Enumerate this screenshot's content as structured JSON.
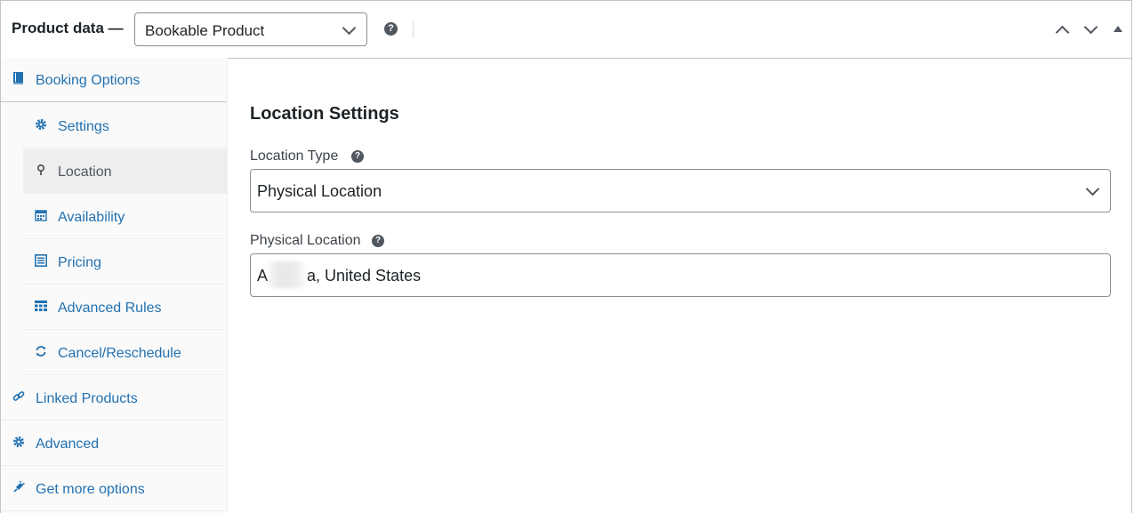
{
  "header": {
    "title": "Product data —",
    "product_type": "Bookable Product"
  },
  "sidebar": {
    "items": [
      {
        "label": "Booking Options",
        "icon": "book-icon"
      },
      {
        "label": "Settings",
        "icon": "gear-icon"
      },
      {
        "label": "Location",
        "icon": "map-pin-icon"
      },
      {
        "label": "Availability",
        "icon": "calendar-icon"
      },
      {
        "label": "Pricing",
        "icon": "list-icon"
      },
      {
        "label": "Advanced Rules",
        "icon": "grid-icon"
      },
      {
        "label": "Cancel/Reschedule",
        "icon": "refresh-icon"
      },
      {
        "label": "Linked Products",
        "icon": "link-icon"
      },
      {
        "label": "Advanced",
        "icon": "gear-icon"
      },
      {
        "label": "Get more options",
        "icon": "plugin-icon"
      }
    ],
    "active": "Location"
  },
  "main": {
    "section_title": "Location Settings",
    "location_type": {
      "label": "Location Type",
      "value": "Physical Location"
    },
    "physical_location": {
      "label": "Physical Location",
      "value_prefix": "A",
      "value_suffix": "a, United States"
    }
  },
  "colors": {
    "link": "#2271b1",
    "active_bg": "#eeeeee",
    "text": "#1d2327"
  }
}
